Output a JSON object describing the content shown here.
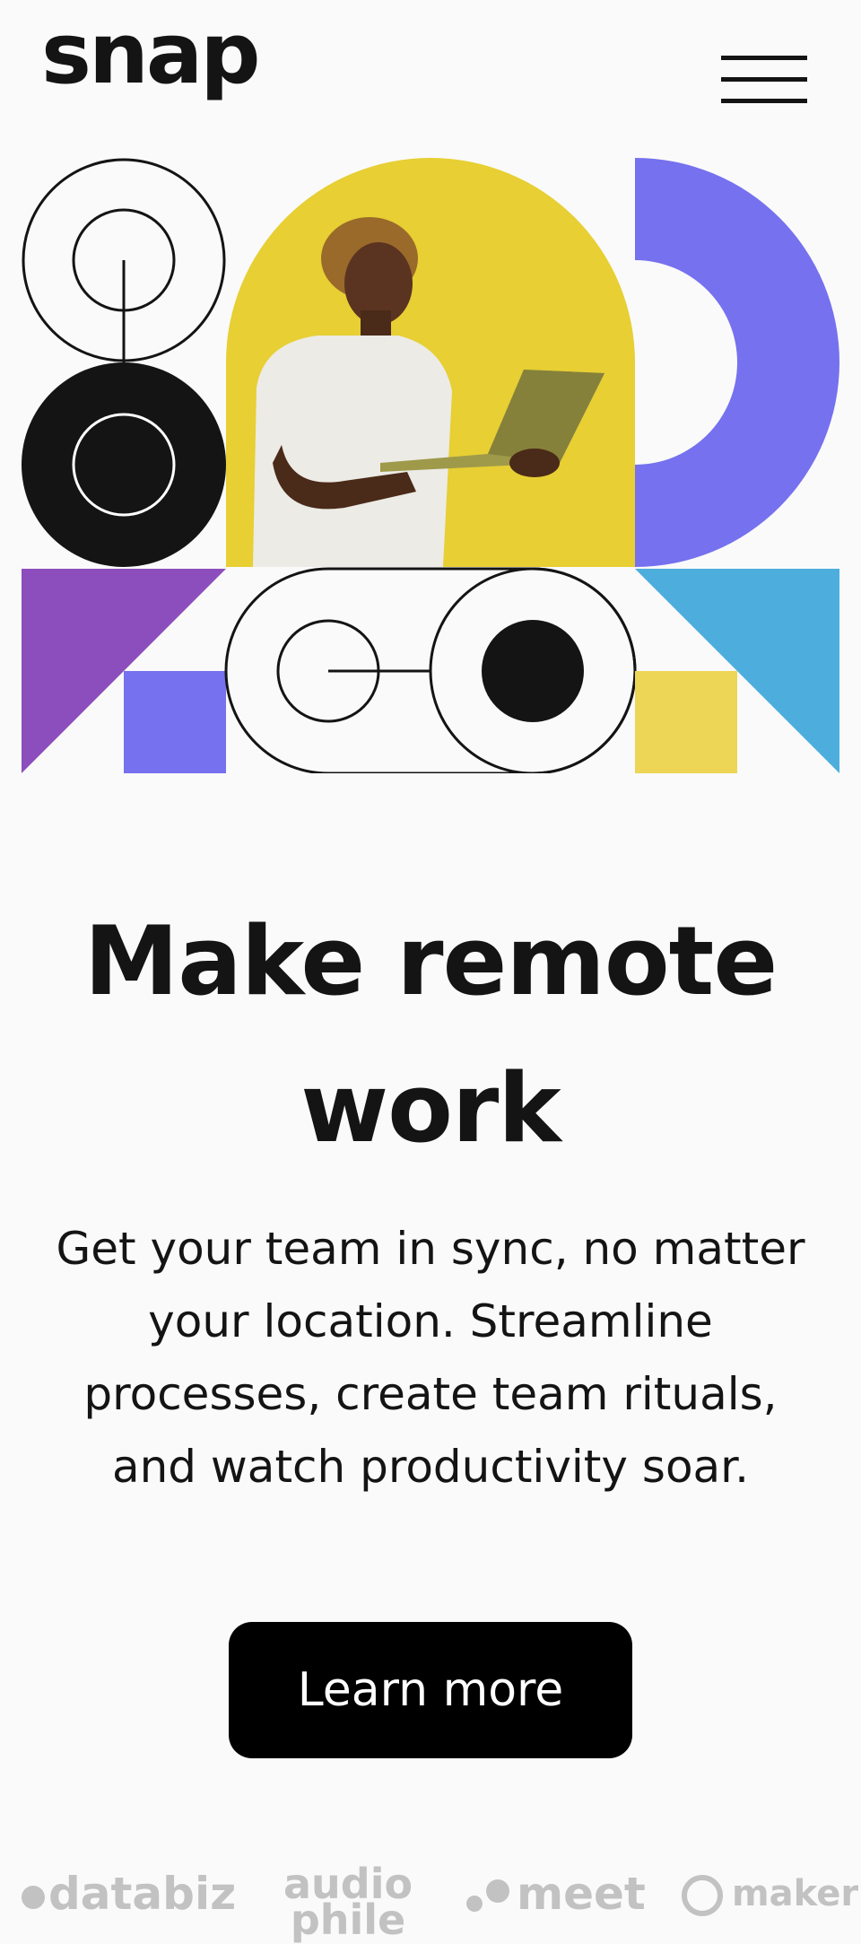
{
  "brand": {
    "logo_text": "snap"
  },
  "hero": {
    "colors": {
      "yellow": "#e7cf34",
      "purple": "#8c4ebc",
      "indigo": "#7571ef",
      "sky": "#4daedd",
      "sand": "#edd555",
      "ink": "#141414"
    }
  },
  "main": {
    "headline": "Make remote work",
    "lead": "Get your team in sync, no matter your location. Streamline processes, create team rituals, and watch productivity soar.",
    "cta_label": "Learn more"
  },
  "clients": {
    "items": [
      {
        "name": "databiz"
      },
      {
        "name": "audio",
        "name2": "phile"
      },
      {
        "name": "meet"
      },
      {
        "name": "maker"
      }
    ]
  },
  "icons": {
    "menu": "hamburger-menu-icon"
  }
}
